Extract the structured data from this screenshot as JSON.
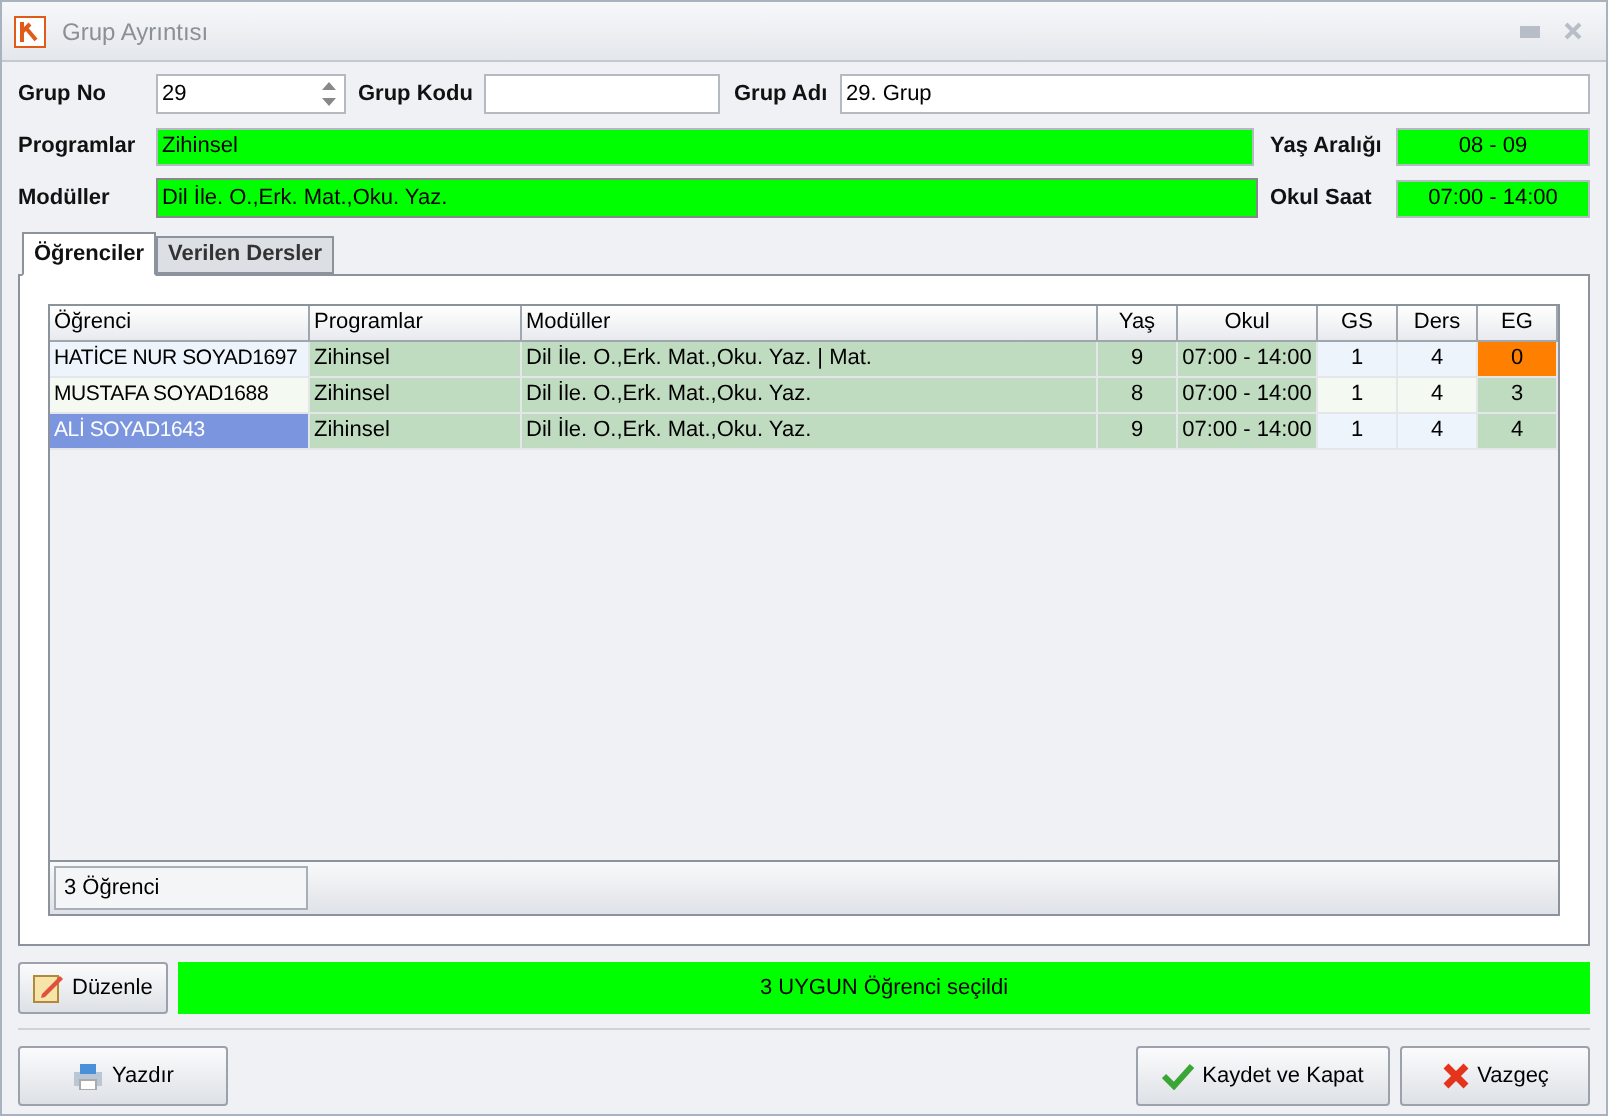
{
  "window": {
    "title": "Grup Ayrıntısı"
  },
  "fields": {
    "grup_no_label": "Grup No",
    "grup_no": "29",
    "grup_kodu_label": "Grup Kodu",
    "grup_adi_label": "Grup Adı",
    "grup_adi": "29. Grup",
    "programlar_label": "Programlar",
    "programlar": "Zihinsel",
    "yas_araligi_label": "Yaş Aralığı",
    "yas_araligi": "08 - 09",
    "moduller_label": "Modüller",
    "moduller": "Dil İle. O.,Erk. Mat.,Oku. Yaz.",
    "okul_saat_label": "Okul Saat",
    "okul_saat": "07:00 - 14:00"
  },
  "tabs": [
    {
      "label": "Öğrenciler",
      "selected": true
    },
    {
      "label": "Verilen Dersler",
      "selected": false
    }
  ],
  "table": {
    "columns": [
      "Öğrenci",
      "Programlar",
      "Modüller",
      "Yaş",
      "Okul",
      "GS",
      "Ders",
      "EG"
    ],
    "rows": [
      {
        "selected": false,
        "cells": [
          "HATİCE NUR SOYAD1697",
          "Zihinsel",
          "Dil İle. O.,Erk. Mat.,Oku. Yaz. | Mat.",
          "9",
          "07:00 - 14:00",
          "1",
          "4",
          "0"
        ],
        "eg_alert": true
      },
      {
        "selected": false,
        "cells": [
          "MUSTAFA SOYAD1688",
          "Zihinsel",
          "Dil İle. O.,Erk. Mat.,Oku. Yaz.",
          "8",
          "07:00 - 14:00",
          "1",
          "4",
          "3"
        ],
        "eg_alert": false
      },
      {
        "selected": true,
        "cells": [
          "ALİ SOYAD1643",
          "Zihinsel",
          "Dil İle. O.,Erk. Mat.,Oku. Yaz.",
          "9",
          "07:00 - 14:00",
          "1",
          "4",
          "4"
        ],
        "eg_alert": false
      }
    ],
    "footer": "3 Öğrenci"
  },
  "edit_button": "Düzenle",
  "status": "3 UYGUN Öğrenci seçildi",
  "buttons": {
    "print": "Yazdır",
    "save": "Kaydet ve Kapat",
    "cancel": "Vazgeç"
  }
}
